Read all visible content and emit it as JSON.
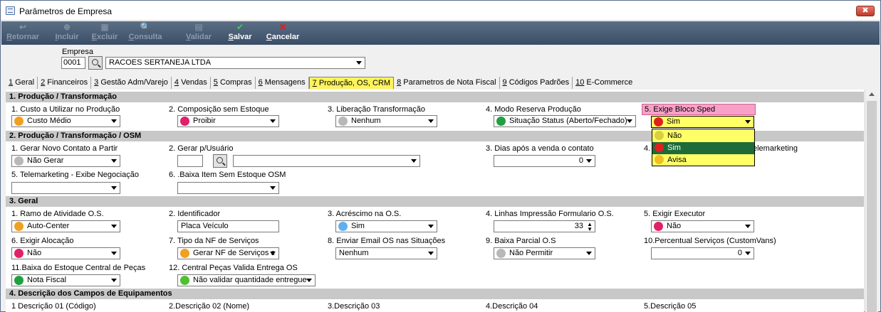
{
  "window": {
    "title": "Parâmetros de Empresa",
    "close_label": "✖"
  },
  "toolbar": {
    "buttons": [
      {
        "label_ul": "R",
        "label_rest": "etornar",
        "icon": "↩"
      },
      {
        "label_ul": "I",
        "label_rest": "ncluir",
        "icon": "⊕"
      },
      {
        "label_ul": "E",
        "label_rest": "xcluir",
        "icon": "▦"
      },
      {
        "label_ul": "C",
        "label_rest": "onsulta",
        "icon": "🔍"
      },
      {
        "label_ul": "V",
        "label_rest": "alidar",
        "icon": "▤"
      },
      {
        "label_ul": "S",
        "label_rest": "alvar",
        "icon": "✔"
      },
      {
        "label_ul": "C",
        "label_rest": "ancelar",
        "icon": "✖"
      }
    ]
  },
  "empresa": {
    "label": "Empresa",
    "code": "0001",
    "name": "RACOES SERTANEJA LTDA"
  },
  "tabs": [
    {
      "num": "1",
      "label": " Geral"
    },
    {
      "num": "2",
      "label": " Financeiros"
    },
    {
      "num": "3",
      "label": " Gestão Adm/Varejo"
    },
    {
      "num": "4",
      "label": " Vendas"
    },
    {
      "num": "5",
      "label": " Compras"
    },
    {
      "num": "6",
      "label": " Mensagens"
    },
    {
      "num": "7",
      "label": " Produção, OS, CRM"
    },
    {
      "num": "8",
      "label": " Parametros de Nota Fiscal"
    },
    {
      "num": "9",
      "label": " Códigos Padrões"
    },
    {
      "num": "10",
      "label": " E-Commerce"
    }
  ],
  "sections": {
    "s1": "1. Produção / Transformação",
    "s2": "2. Produção / Transformação / OSM",
    "s3": "3. Geral",
    "s4": "4. Descrição dos Campos de Equipamentos"
  },
  "s1": {
    "f1": {
      "label": "1. Custo a Utilizar no Produção",
      "value": "Custo Médio",
      "color": "#f0a020"
    },
    "f2": {
      "label": "2. Composição sem Estoque",
      "value": "Proibir",
      "color": "#e0206a"
    },
    "f3": {
      "label": "3. Liberação Transformação",
      "value": "Nenhum",
      "color": "#b8b8b8"
    },
    "f4": {
      "label": "4. Modo Reserva Produção",
      "value": "Situação Status (Aberto/Fechado)",
      "color": "#20a040"
    },
    "f5": {
      "label": "5. Exige Bloco Sped",
      "value": "Sim",
      "color": "#e02020"
    }
  },
  "dropdown": {
    "items": [
      {
        "label": "Não",
        "color": "#d8d040"
      },
      {
        "label": "Sim",
        "color": "#e02020"
      },
      {
        "label": "Avisa",
        "color": "#f0c020"
      }
    ]
  },
  "s2": {
    "f1": {
      "label": "1. Gerar Novo Contato a Partir",
      "value": "Não Gerar",
      "color": "#b8b8b8"
    },
    "f2": {
      "label": "2. Gerar p/Usuário",
      "value": ""
    },
    "f3": {
      "label": "3. Dias após a venda o contato",
      "value": "0"
    },
    "f4": {
      "label_pre": "4.",
      "label_post": "elemarketing"
    },
    "f5": {
      "label": "5. Telemarketing - Exibe Negociação",
      "value": ""
    },
    "f6": {
      "label": "6. .Baixa Item Sem Estoque OSM",
      "value": ""
    }
  },
  "s3": {
    "f1": {
      "label": "1. Ramo de Atividade O.S.",
      "value": "Auto-Center",
      "color": "#f0a020"
    },
    "f2": {
      "label": "2. Identificador",
      "value": "Placa Veículo"
    },
    "f3": {
      "label": "3. Acréscimo na O.S.",
      "value": "Sim",
      "color": "#60b0f0"
    },
    "f4": {
      "label": "4. Linhas Impressão Formulario O.S.",
      "value": "33"
    },
    "f5": {
      "label": "5. Exigir Executor",
      "value": "Não",
      "color": "#e0206a"
    },
    "f6": {
      "label": "6. Exigir Alocação",
      "value": "Não",
      "color": "#e0206a"
    },
    "f7": {
      "label": "7. Tipo da NF de Serviços",
      "value": "Gerar NF de Serviços c",
      "color": "#f0a020"
    },
    "f8": {
      "label": "8. Enviar Email OS nas Situações",
      "value": "Nenhum"
    },
    "f9": {
      "label": "9. Baixa Parcial O.S",
      "value": "Não Permitir",
      "color": "#b8b8b8"
    },
    "f10": {
      "label": "10.Percentual Serviços (CustomVans)",
      "value": "0"
    },
    "f11": {
      "label": "11.Baixa do Estoque Central de Peças",
      "value": "Nota Fiscal",
      "color": "#20a040"
    },
    "f12": {
      "label": "12. Central Peças Valida Entrega OS",
      "value": "Não validar quantidade entregue",
      "color": "#50c030"
    }
  },
  "s4": {
    "d1": "1 Descrição 01 (Código)",
    "d2": "2.Descrição 02 (Nome)",
    "d3": "3.Descrição 03",
    "d4": "4.Descrição 04",
    "d5": "5.Descrição 05"
  }
}
